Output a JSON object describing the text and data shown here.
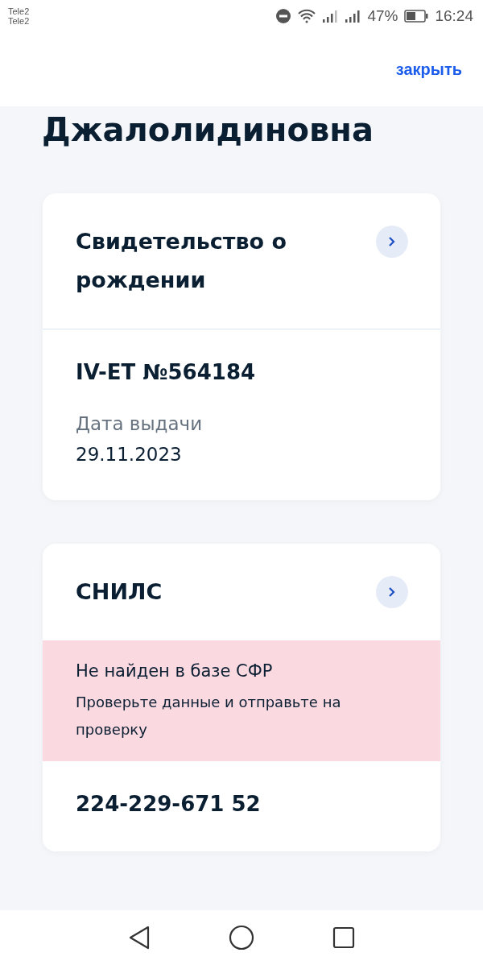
{
  "status_bar": {
    "carriers": [
      "Tele2",
      "Tele2"
    ],
    "battery": "47%",
    "time": "16:24"
  },
  "header": {
    "close": "закрыть"
  },
  "heading": "Джалолидиновна",
  "cards": [
    {
      "title": "Свидетельство о рождении",
      "sections": [
        {
          "kind": "details",
          "number": "IV-ET №564184",
          "label": "Дата выдачи",
          "value": "29.11.2023"
        }
      ]
    },
    {
      "title": "СНИЛС",
      "sections": [
        {
          "kind": "alert",
          "title": "Не найден в базе СФР",
          "text": "Проверьте данные и отправьте на проверку"
        },
        {
          "kind": "details",
          "number": "224-229-671 52"
        }
      ]
    }
  ]
}
